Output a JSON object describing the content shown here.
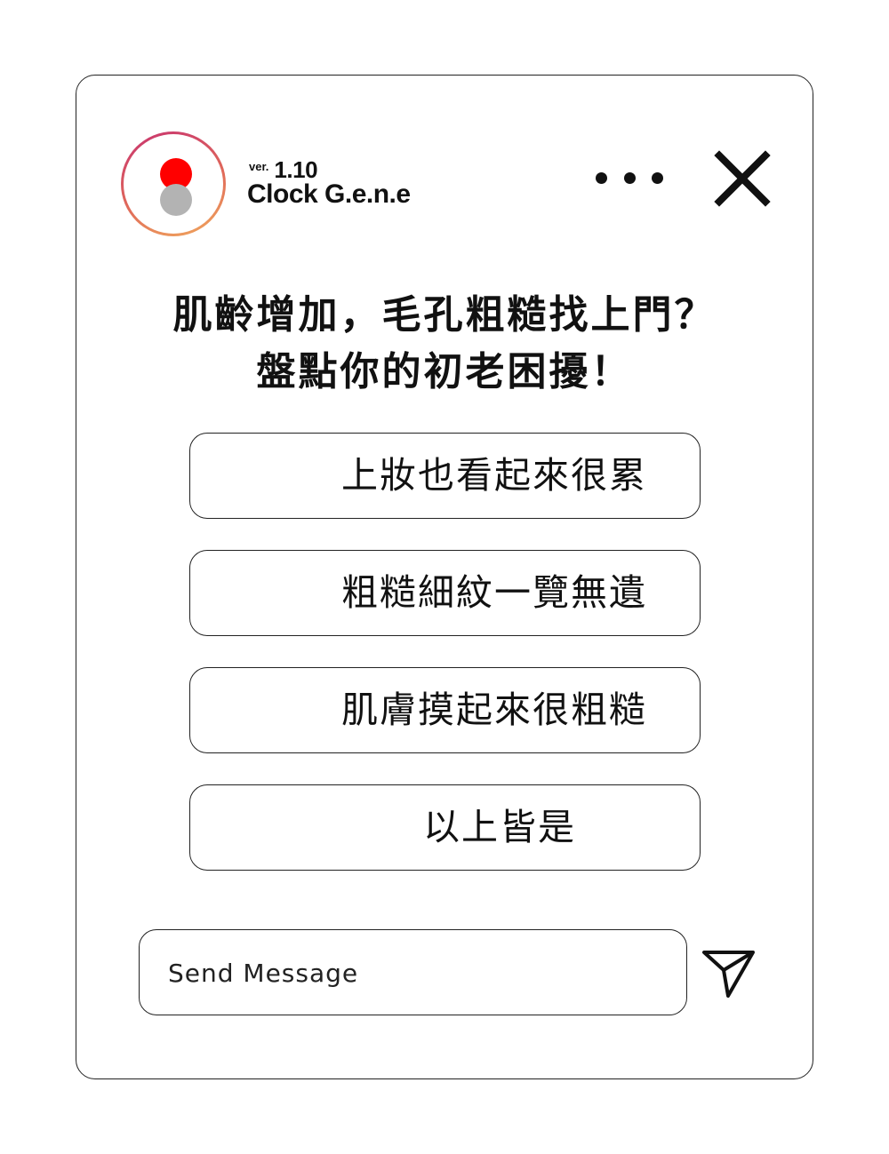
{
  "header": {
    "version_prefix": "ver.",
    "version_number": "1.10",
    "app_name": "Clock G.e.n.e",
    "icons": [
      "avatar-logo",
      "more-dots-icon",
      "close-icon"
    ]
  },
  "headline": {
    "line1": "肌齡增加，毛孔粗糙找上門？",
    "line2": "盤點你的初老困擾！"
  },
  "options": [
    "上妝也看起來很累",
    "粗糙細紋一覽無遺",
    "肌膚摸起來很粗糙",
    "以上皆是"
  ],
  "composer": {
    "placeholder": "Send Message",
    "send_icon": "paper-plane-icon"
  },
  "colors": {
    "logo_dot_primary": "#ff0000",
    "logo_dot_secondary": "#b3b3b3",
    "logo_ring_gradient": [
      "#c8326f",
      "#f1a95c"
    ],
    "border": "#222222"
  }
}
